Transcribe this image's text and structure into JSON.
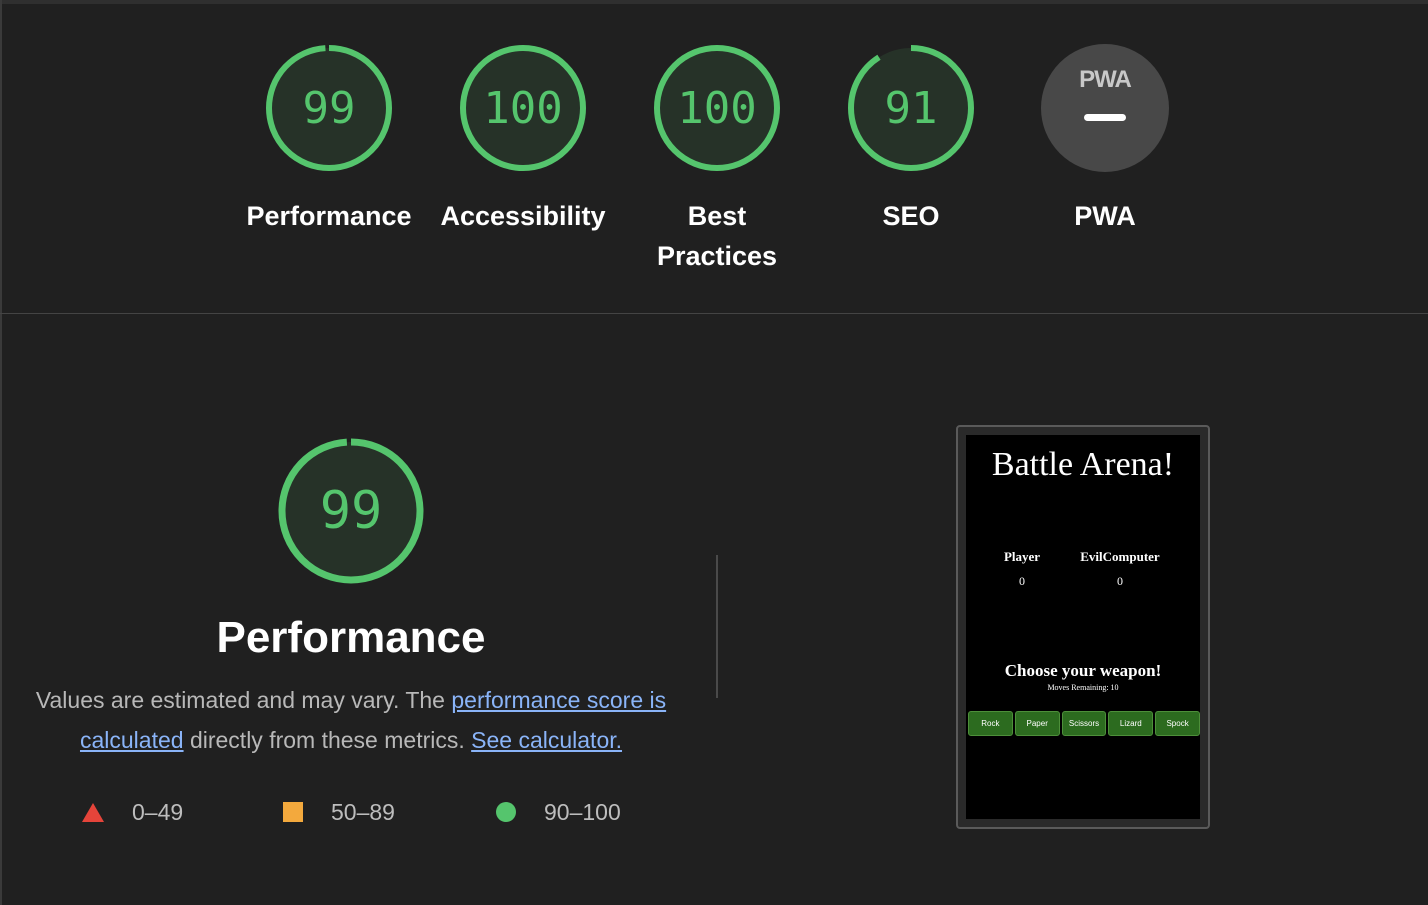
{
  "categories": [
    {
      "label": "Performance",
      "score": "99",
      "fraction": 0.99
    },
    {
      "label": "Accessibility",
      "score": "100",
      "fraction": 1.0
    },
    {
      "label": "Best Practices",
      "score": "100",
      "fraction": 1.0
    },
    {
      "label": "SEO",
      "score": "91",
      "fraction": 0.91
    }
  ],
  "pwa": {
    "label": "PWA",
    "logo_text": "PWA"
  },
  "performance": {
    "score": "99",
    "fraction": 0.99,
    "title": "Performance",
    "desc_prefix": "Values are estimated and may vary. The ",
    "desc_link1": "performance score is calculated",
    "desc_middle": " directly from these metrics. ",
    "desc_link2": "See calculator."
  },
  "legend": [
    {
      "icon": "triangle-icon",
      "range": "0–49",
      "color": "#e5443a"
    },
    {
      "icon": "square-icon",
      "range": "50–89",
      "color": "#f3a93d"
    },
    {
      "icon": "circle-icon",
      "range": "90–100",
      "color": "#55c56d"
    }
  ],
  "thumbnail": {
    "title": "Battle Arena!",
    "player_label": "Player",
    "player_score": "0",
    "computer_label": "EvilComputer",
    "computer_score": "0",
    "prompt": "Choose your weapon!",
    "moves": "Moves Remaining: 10",
    "buttons": [
      "Rock",
      "Paper",
      "Scissors",
      "Lizard",
      "Spock"
    ]
  },
  "colors": {
    "pass": "#55c56d",
    "average": "#f3a93d",
    "fail": "#e5443a",
    "background": "#202020"
  }
}
